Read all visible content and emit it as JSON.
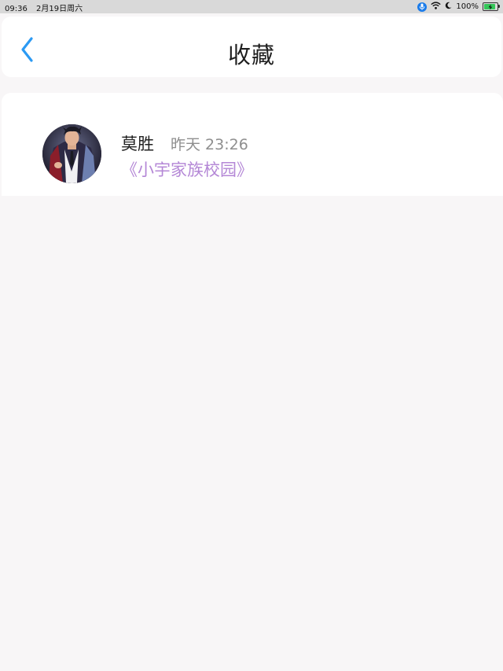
{
  "status_bar": {
    "time": "09:36",
    "date": "2月19日周六",
    "battery": "100%",
    "icons": [
      "microphone-icon",
      "wifi-icon",
      "moon-icon",
      "battery-icon"
    ]
  },
  "header": {
    "title": "收藏",
    "back_icon": "chevron-left-icon"
  },
  "items": [
    {
      "name": "莫胜",
      "time": "昨天 23:26",
      "title": "《小宇家族校园》"
    }
  ],
  "colors": {
    "accent": "#2b9af3",
    "link_purple": "#b487d6",
    "background": "#f8f6f7",
    "status_bar_bg": "#d9d9d9"
  }
}
